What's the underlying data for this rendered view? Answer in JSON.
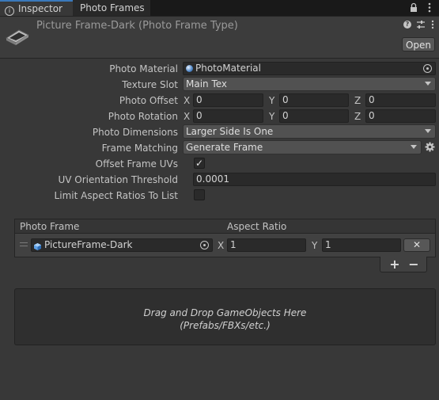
{
  "tabs": [
    {
      "label": "Inspector",
      "icon": "info-icon",
      "active": true
    },
    {
      "label": "Photo Frames",
      "active": false
    }
  ],
  "tab_controls": {
    "lock": "lock-icon",
    "menu": "kebab-menu-icon"
  },
  "header": {
    "title": "Picture Frame-Dark (Photo Frame Type)",
    "open_label": "Open",
    "icons": [
      "help-icon",
      "preset-icon",
      "kebab-menu-icon"
    ]
  },
  "properties": {
    "photo_material": {
      "label": "Photo Material",
      "value": "PhotoMaterial"
    },
    "texture_slot": {
      "label": "Texture Slot",
      "value": "Main Tex"
    },
    "photo_offset": {
      "label": "Photo Offset",
      "x_label": "X",
      "y_label": "Y",
      "z_label": "Z",
      "x": "0",
      "y": "0",
      "z": "0"
    },
    "photo_rotation": {
      "label": "Photo Rotation",
      "x_label": "X",
      "y_label": "Y",
      "z_label": "Z",
      "x": "0",
      "y": "0",
      "z": "0"
    },
    "photo_dimensions": {
      "label": "Photo Dimensions",
      "value": "Larger Side Is One"
    },
    "frame_matching": {
      "label": "Frame Matching",
      "value": "Generate Frame"
    },
    "offset_frame_uvs": {
      "label": "Offset Frame UVs",
      "checked": true,
      "mark": "✓"
    },
    "uv_orientation_threshold": {
      "label": "UV Orientation Threshold",
      "value": "0.0001"
    },
    "limit_aspect_ratios": {
      "label": "Limit Aspect Ratios To List",
      "checked": false
    }
  },
  "list": {
    "headers": {
      "photo_frame": "Photo Frame",
      "aspect_ratio": "Aspect Ratio"
    },
    "items": [
      {
        "frame": "PictureFrame-Dark",
        "x_label": "X",
        "x": "1",
        "y_label": "Y",
        "y": "1",
        "remove": "✕"
      }
    ],
    "add_label": "+",
    "remove_label": "−"
  },
  "drop_area": {
    "line1": "Drag and Drop GameObjects Here",
    "line2": "(Prefabs/FBXs/etc.)"
  }
}
